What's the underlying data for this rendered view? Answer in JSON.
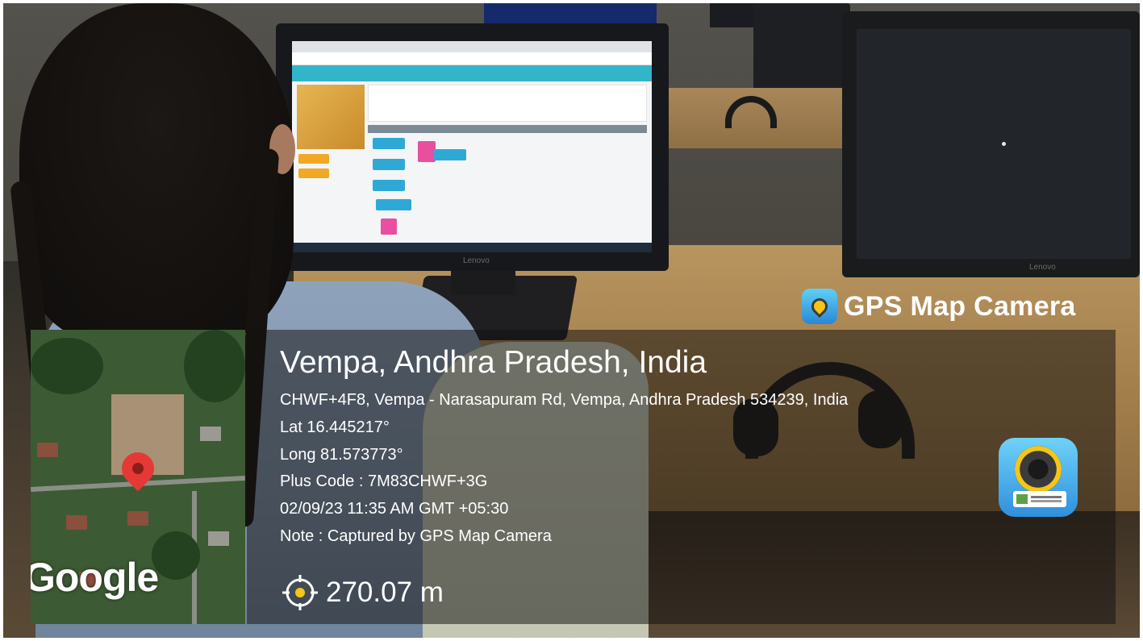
{
  "overlay": {
    "brand": "GPS Map Camera",
    "location_title": "Vempa, Andhra Pradesh, India",
    "address": "CHWF+4F8, Vempa - Narasapuram Rd, Vempa, Andhra Pradesh 534239, India",
    "latitude": "Lat 16.445217°",
    "longitude": "Long 81.573773°",
    "plus_code": "Plus Code : 7M83CHWF+3G",
    "datetime": "02/09/23 11:35 AM GMT +05:30",
    "note": "Note : Captured by GPS Map Camera",
    "altitude": "270.07 m",
    "map_attribution": "Google"
  },
  "scene": {
    "monitor_brand": "Lenovo",
    "icons": [
      "gps-map-camera-icon",
      "map-pin-icon",
      "altitude-crosshair-icon",
      "app-logo-icon"
    ]
  },
  "colors": {
    "pin_red": "#e53935",
    "overlay_text": "#ffffff",
    "screen_header": "#33b5c9"
  }
}
